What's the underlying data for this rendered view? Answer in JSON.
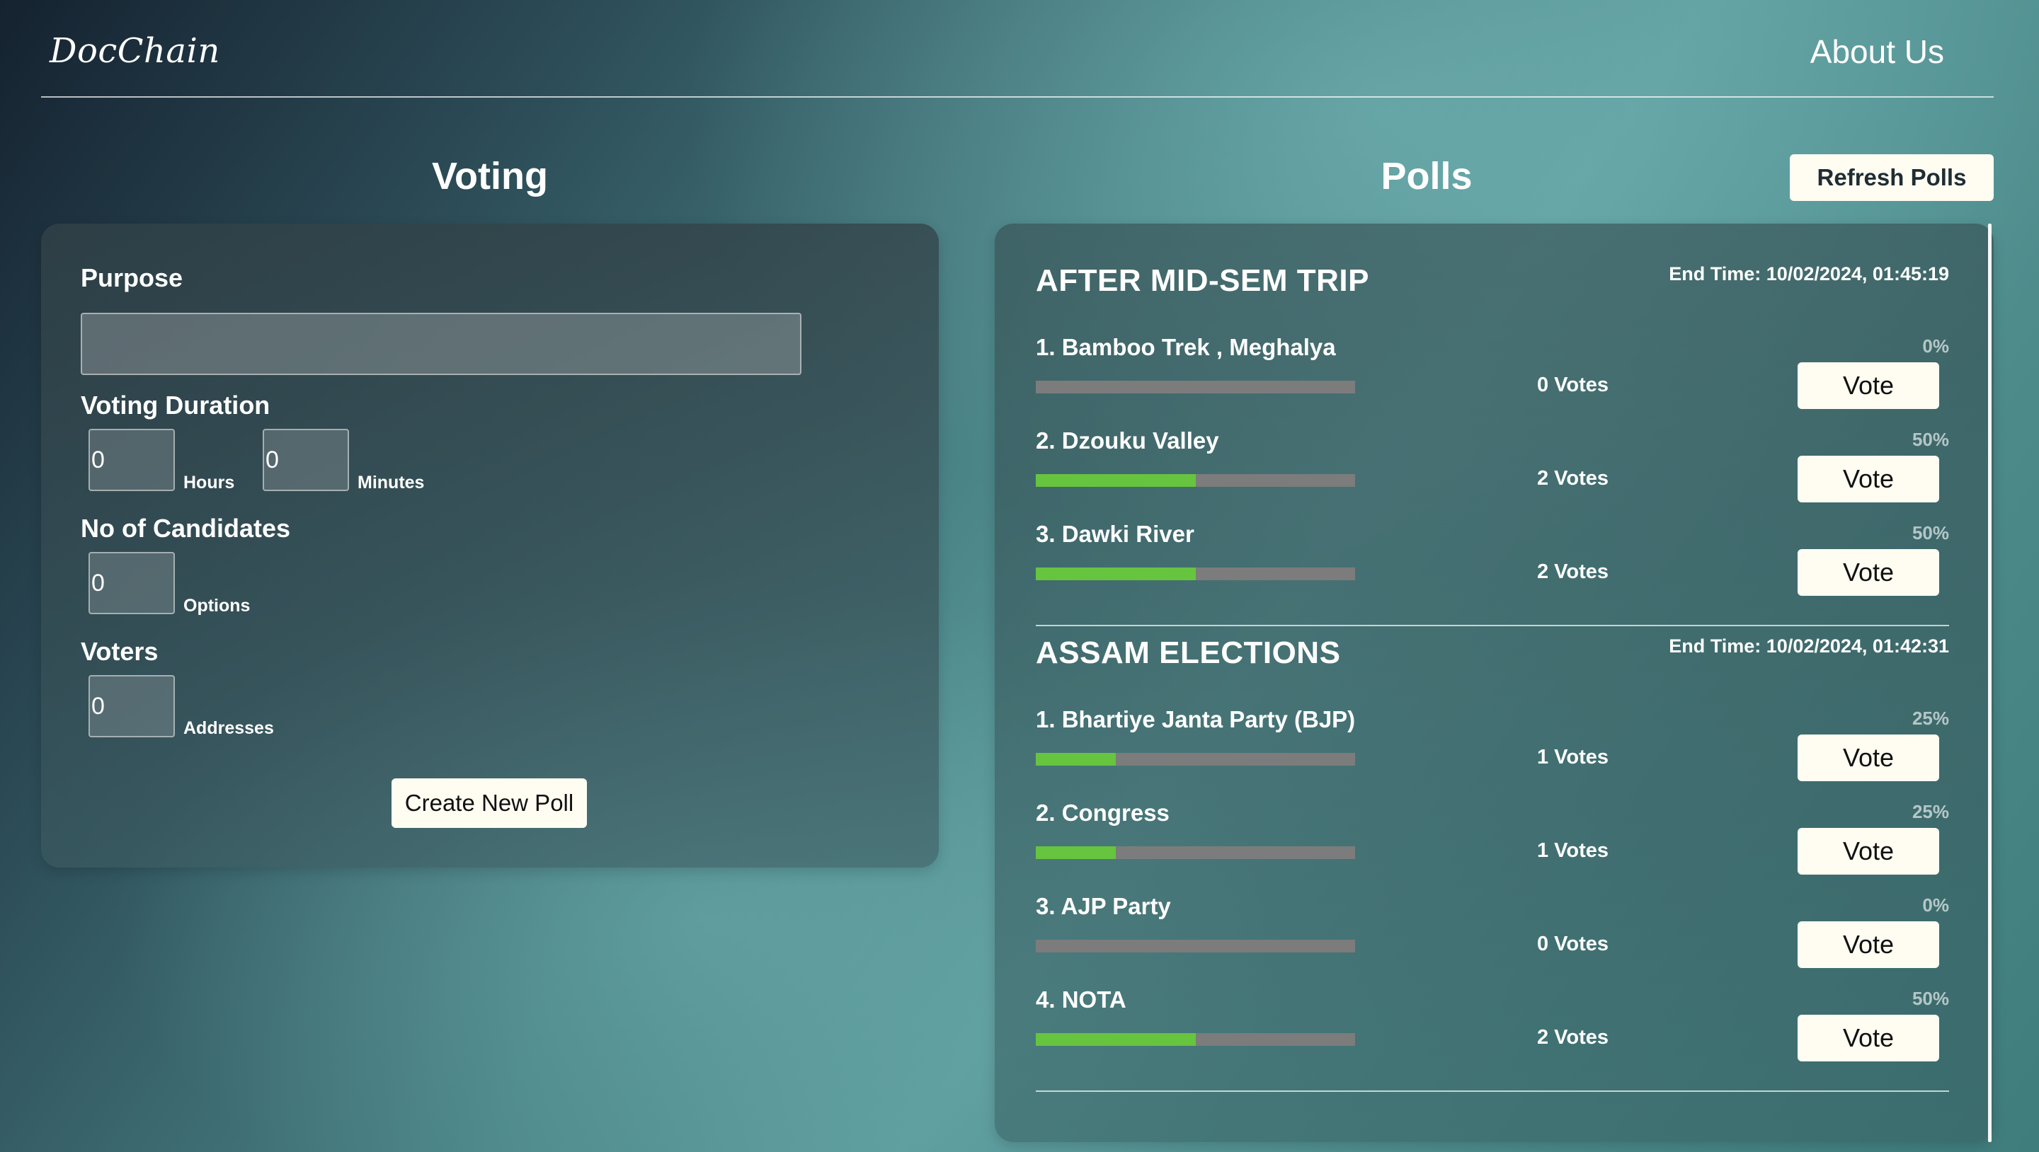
{
  "nav": {
    "logo": "DocChain",
    "about": "About Us"
  },
  "voting": {
    "title": "Voting",
    "purpose_label": "Purpose",
    "purpose_value": "",
    "duration_label": "Voting Duration",
    "hours_value": "0",
    "hours_unit": "Hours",
    "minutes_value": "0",
    "minutes_unit": "Minutes",
    "candidates_label": "No of Candidates",
    "candidates_value": "0",
    "candidates_unit": "Options",
    "voters_label": "Voters",
    "voters_value": "0",
    "voters_unit": "Addresses",
    "create_button": "Create New Poll"
  },
  "polls_section": {
    "title": "Polls",
    "refresh_button": "Refresh Polls",
    "vote_button": "Vote",
    "polls": [
      {
        "title": "AFTER MID-SEM TRIP",
        "end_time": "End Time: 10/02/2024, 01:45:19",
        "options": [
          {
            "name": "1. Bamboo Trek , Meghalya",
            "percent_text": "0%",
            "percent": 0,
            "votes_text": "0 Votes"
          },
          {
            "name": "2. Dzouku Valley",
            "percent_text": "50%",
            "percent": 50,
            "votes_text": "2 Votes"
          },
          {
            "name": "3. Dawki River",
            "percent_text": "50%",
            "percent": 50,
            "votes_text": "2 Votes"
          }
        ]
      },
      {
        "title": "ASSAM ELECTIONS",
        "end_time": "End Time: 10/02/2024, 01:42:31",
        "options": [
          {
            "name": "1. Bhartiye Janta Party (BJP)",
            "percent_text": "25%",
            "percent": 25,
            "votes_text": "1 Votes"
          },
          {
            "name": "2. Congress",
            "percent_text": "25%",
            "percent": 25,
            "votes_text": "1 Votes"
          },
          {
            "name": "3. AJP Party",
            "percent_text": "0%",
            "percent": 0,
            "votes_text": "0 Votes"
          },
          {
            "name": "4. NOTA",
            "percent_text": "50%",
            "percent": 50,
            "votes_text": "2 Votes"
          }
        ]
      }
    ]
  },
  "colors": {
    "bar_fill": "#66c43f",
    "bar_track": "#7c7c7c",
    "button_bg": "#fffdf2"
  }
}
